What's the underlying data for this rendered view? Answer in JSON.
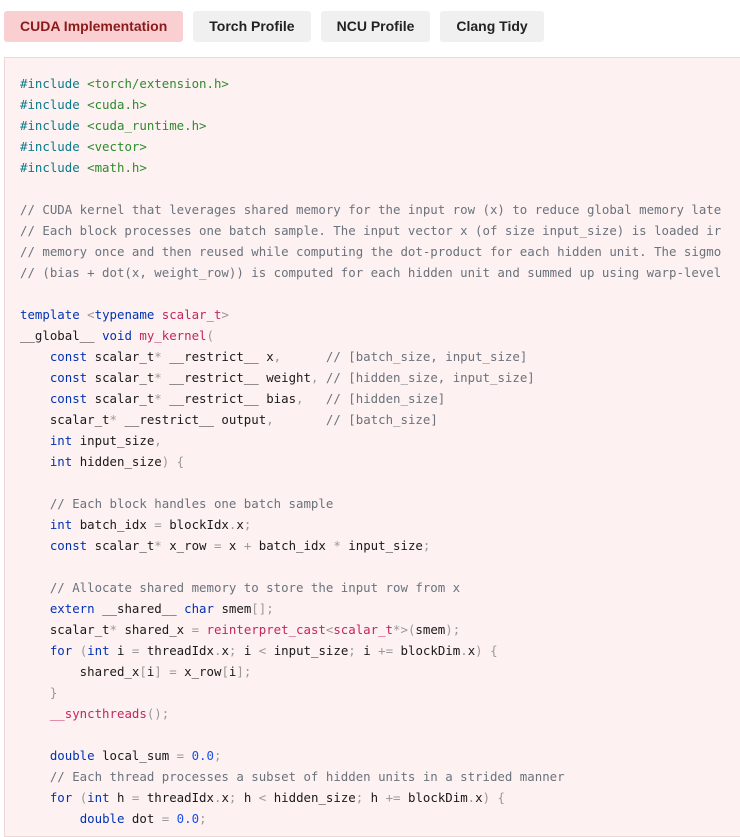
{
  "tabs": [
    {
      "label": "CUDA Implementation",
      "active": true
    },
    {
      "label": "Torch Profile",
      "active": false
    },
    {
      "label": "NCU Profile",
      "active": false
    },
    {
      "label": "Clang Tidy",
      "active": false
    }
  ],
  "code": {
    "language": "cuda",
    "lines": [
      [
        [
          "pp",
          "#include "
        ],
        [
          "inc",
          "<torch/extension.h>"
        ]
      ],
      [
        [
          "pp",
          "#include "
        ],
        [
          "inc",
          "<cuda.h>"
        ]
      ],
      [
        [
          "pp",
          "#include "
        ],
        [
          "inc",
          "<cuda_runtime.h>"
        ]
      ],
      [
        [
          "pp",
          "#include "
        ],
        [
          "inc",
          "<vector>"
        ]
      ],
      [
        [
          "pp",
          "#include "
        ],
        [
          "inc",
          "<math.h>"
        ]
      ],
      [],
      [
        [
          "cm",
          "// CUDA kernel that leverages shared memory for the input row (x) to reduce global memory late"
        ]
      ],
      [
        [
          "cm",
          "// Each block processes one batch sample. The input vector x (of size input_size) is loaded ir"
        ]
      ],
      [
        [
          "cm",
          "// memory once and then reused while computing the dot-product for each hidden unit. The sigmo"
        ]
      ],
      [
        [
          "cm",
          "// (bias + dot(x, weight_row)) is computed for each hidden unit and summed up using warp-level"
        ]
      ],
      [],
      [
        [
          "kw",
          "template "
        ],
        [
          "op",
          "<"
        ],
        [
          "kw",
          "typename "
        ],
        [
          "ty",
          "scalar_t"
        ],
        [
          "op",
          ">"
        ]
      ],
      [
        [
          "tx",
          "__global__ "
        ],
        [
          "kw",
          "void "
        ],
        [
          "fn",
          "my_kernel"
        ],
        [
          "op",
          "("
        ]
      ],
      [
        [
          "tx",
          "    "
        ],
        [
          "kw",
          "const "
        ],
        [
          "tx",
          "scalar_t"
        ],
        [
          "op",
          "* "
        ],
        [
          "tx",
          "__restrict__ x"
        ],
        [
          "op",
          ",      "
        ],
        [
          "cm",
          "// [batch_size, input_size]"
        ]
      ],
      [
        [
          "tx",
          "    "
        ],
        [
          "kw",
          "const "
        ],
        [
          "tx",
          "scalar_t"
        ],
        [
          "op",
          "* "
        ],
        [
          "tx",
          "__restrict__ weight"
        ],
        [
          "op",
          ", "
        ],
        [
          "cm",
          "// [hidden_size, input_size]"
        ]
      ],
      [
        [
          "tx",
          "    "
        ],
        [
          "kw",
          "const "
        ],
        [
          "tx",
          "scalar_t"
        ],
        [
          "op",
          "* "
        ],
        [
          "tx",
          "__restrict__ bias"
        ],
        [
          "op",
          ",   "
        ],
        [
          "cm",
          "// [hidden_size]"
        ]
      ],
      [
        [
          "tx",
          "    scalar_t"
        ],
        [
          "op",
          "* "
        ],
        [
          "tx",
          "__restrict__ output"
        ],
        [
          "op",
          ",       "
        ],
        [
          "cm",
          "// [batch_size]"
        ]
      ],
      [
        [
          "tx",
          "    "
        ],
        [
          "kw",
          "int "
        ],
        [
          "tx",
          "input_size"
        ],
        [
          "op",
          ","
        ]
      ],
      [
        [
          "tx",
          "    "
        ],
        [
          "kw",
          "int "
        ],
        [
          "tx",
          "hidden_size"
        ],
        [
          "op",
          ") {"
        ]
      ],
      [],
      [
        [
          "tx",
          "    "
        ],
        [
          "cm",
          "// Each block handles one batch sample"
        ]
      ],
      [
        [
          "tx",
          "    "
        ],
        [
          "kw",
          "int "
        ],
        [
          "tx",
          "batch_idx "
        ],
        [
          "op",
          "= "
        ],
        [
          "tx",
          "blockIdx"
        ],
        [
          "op",
          "."
        ],
        [
          "tx",
          "x"
        ],
        [
          "op",
          ";"
        ]
      ],
      [
        [
          "tx",
          "    "
        ],
        [
          "kw",
          "const "
        ],
        [
          "tx",
          "scalar_t"
        ],
        [
          "op",
          "* "
        ],
        [
          "tx",
          "x_row "
        ],
        [
          "op",
          "= "
        ],
        [
          "tx",
          "x "
        ],
        [
          "op",
          "+ "
        ],
        [
          "tx",
          "batch_idx "
        ],
        [
          "op",
          "* "
        ],
        [
          "tx",
          "input_size"
        ],
        [
          "op",
          ";"
        ]
      ],
      [],
      [
        [
          "tx",
          "    "
        ],
        [
          "cm",
          "// Allocate shared memory to store the input row from x"
        ]
      ],
      [
        [
          "tx",
          "    "
        ],
        [
          "kw",
          "extern "
        ],
        [
          "tx",
          "__shared__ "
        ],
        [
          "kw",
          "char "
        ],
        [
          "tx",
          "smem"
        ],
        [
          "op",
          "[];"
        ]
      ],
      [
        [
          "tx",
          "    scalar_t"
        ],
        [
          "op",
          "* "
        ],
        [
          "tx",
          "shared_x "
        ],
        [
          "op",
          "= "
        ],
        [
          "fn",
          "reinterpret_cast"
        ],
        [
          "op",
          "<"
        ],
        [
          "ty",
          "scalar_t"
        ],
        [
          "op",
          "*>("
        ],
        [
          "tx",
          "smem"
        ],
        [
          "op",
          ");"
        ]
      ],
      [
        [
          "tx",
          "    "
        ],
        [
          "kw",
          "for "
        ],
        [
          "op",
          "("
        ],
        [
          "kw",
          "int "
        ],
        [
          "tx",
          "i "
        ],
        [
          "op",
          "= "
        ],
        [
          "tx",
          "threadIdx"
        ],
        [
          "op",
          "."
        ],
        [
          "tx",
          "x"
        ],
        [
          "op",
          "; "
        ],
        [
          "tx",
          "i "
        ],
        [
          "op",
          "< "
        ],
        [
          "tx",
          "input_size"
        ],
        [
          "op",
          "; "
        ],
        [
          "tx",
          "i "
        ],
        [
          "op",
          "+= "
        ],
        [
          "tx",
          "blockDim"
        ],
        [
          "op",
          "."
        ],
        [
          "tx",
          "x"
        ],
        [
          "op",
          ") {"
        ]
      ],
      [
        [
          "tx",
          "        shared_x"
        ],
        [
          "op",
          "["
        ],
        [
          "tx",
          "i"
        ],
        [
          "op",
          "] = "
        ],
        [
          "tx",
          "x_row"
        ],
        [
          "op",
          "["
        ],
        [
          "tx",
          "i"
        ],
        [
          "op",
          "];"
        ]
      ],
      [
        [
          "tx",
          "    "
        ],
        [
          "op",
          "}"
        ]
      ],
      [
        [
          "tx",
          "    "
        ],
        [
          "fn",
          "__syncthreads"
        ],
        [
          "op",
          "();"
        ]
      ],
      [],
      [
        [
          "tx",
          "    "
        ],
        [
          "kw",
          "double "
        ],
        [
          "tx",
          "local_sum "
        ],
        [
          "op",
          "= "
        ],
        [
          "num",
          "0.0"
        ],
        [
          "op",
          ";"
        ]
      ],
      [
        [
          "tx",
          "    "
        ],
        [
          "cm",
          "// Each thread processes a subset of hidden units in a strided manner"
        ]
      ],
      [
        [
          "tx",
          "    "
        ],
        [
          "kw",
          "for "
        ],
        [
          "op",
          "("
        ],
        [
          "kw",
          "int "
        ],
        [
          "tx",
          "h "
        ],
        [
          "op",
          "= "
        ],
        [
          "tx",
          "threadIdx"
        ],
        [
          "op",
          "."
        ],
        [
          "tx",
          "x"
        ],
        [
          "op",
          "; "
        ],
        [
          "tx",
          "h "
        ],
        [
          "op",
          "< "
        ],
        [
          "tx",
          "hidden_size"
        ],
        [
          "op",
          "; "
        ],
        [
          "tx",
          "h "
        ],
        [
          "op",
          "+= "
        ],
        [
          "tx",
          "blockDim"
        ],
        [
          "op",
          "."
        ],
        [
          "tx",
          "x"
        ],
        [
          "op",
          ") {"
        ]
      ],
      [
        [
          "tx",
          "        "
        ],
        [
          "kw",
          "double "
        ],
        [
          "tx",
          "dot "
        ],
        [
          "op",
          "= "
        ],
        [
          "num",
          "0.0"
        ],
        [
          "op",
          ";"
        ]
      ]
    ]
  }
}
